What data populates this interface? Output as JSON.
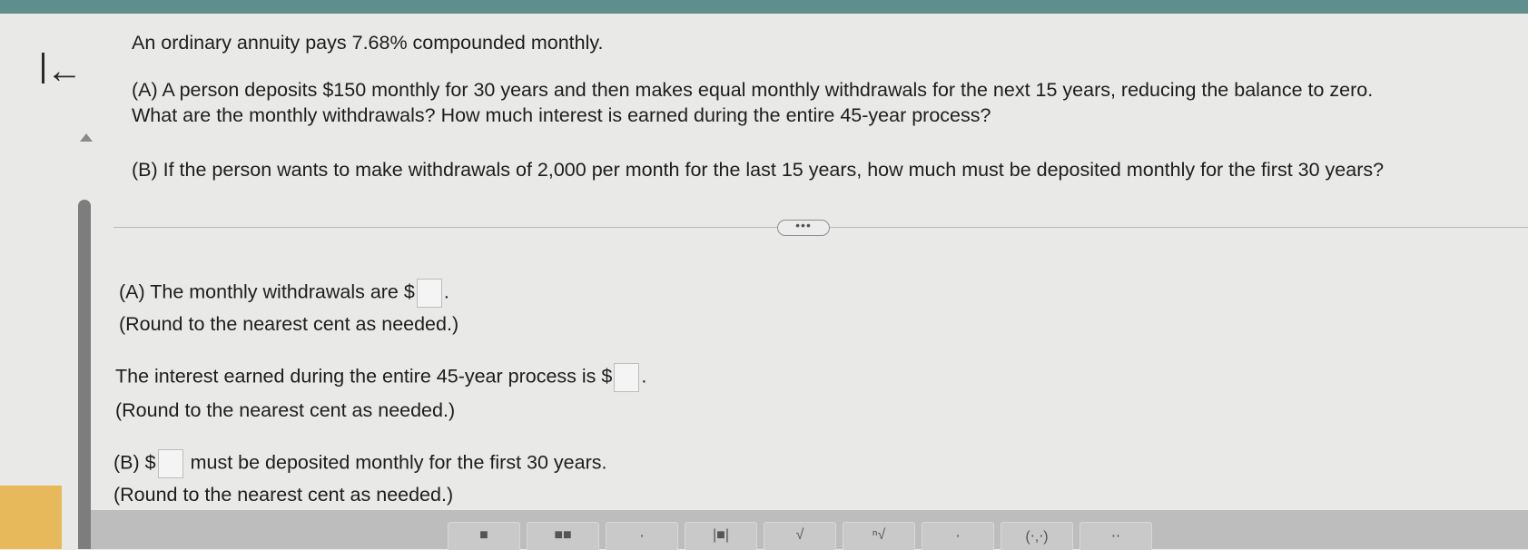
{
  "question": {
    "intro": "An ordinary annuity pays 7.68% compounded monthly.",
    "part_a_line1": "(A) A person deposits $150 monthly for 30 years and then makes equal monthly withdrawals for the next 15 years, reducing the balance to zero.",
    "part_a_line2": "What are the monthly withdrawals? How much interest is earned during the entire 45-year process?",
    "part_b": "(B) If the person wants to make withdrawals of 2,000 per month for the last 15 years, how much must be deposited monthly for the first 30 years?"
  },
  "more_button": "•••",
  "answers": {
    "a1_prefix": "(A) The monthly withdrawals are $",
    "a1_suffix": ".",
    "a1_note": "(Round to the nearest cent as needed.)",
    "a2_prefix": "The interest earned during the entire 45-year process is $",
    "a2_suffix": ".",
    "a2_note": "(Round to the nearest cent as needed.)",
    "b_prefix": "(B) $",
    "b_suffix": "must be deposited monthly for the first 30 years.",
    "b_note": "(Round to the nearest cent as needed.)"
  },
  "icons": {
    "back": "back-to-first-icon",
    "scroll_up": "triangle-up-icon"
  },
  "colors": {
    "top_bar": "#5f8f8d",
    "background": "#e9e9e7",
    "toolbar": "#bdbdbd"
  }
}
